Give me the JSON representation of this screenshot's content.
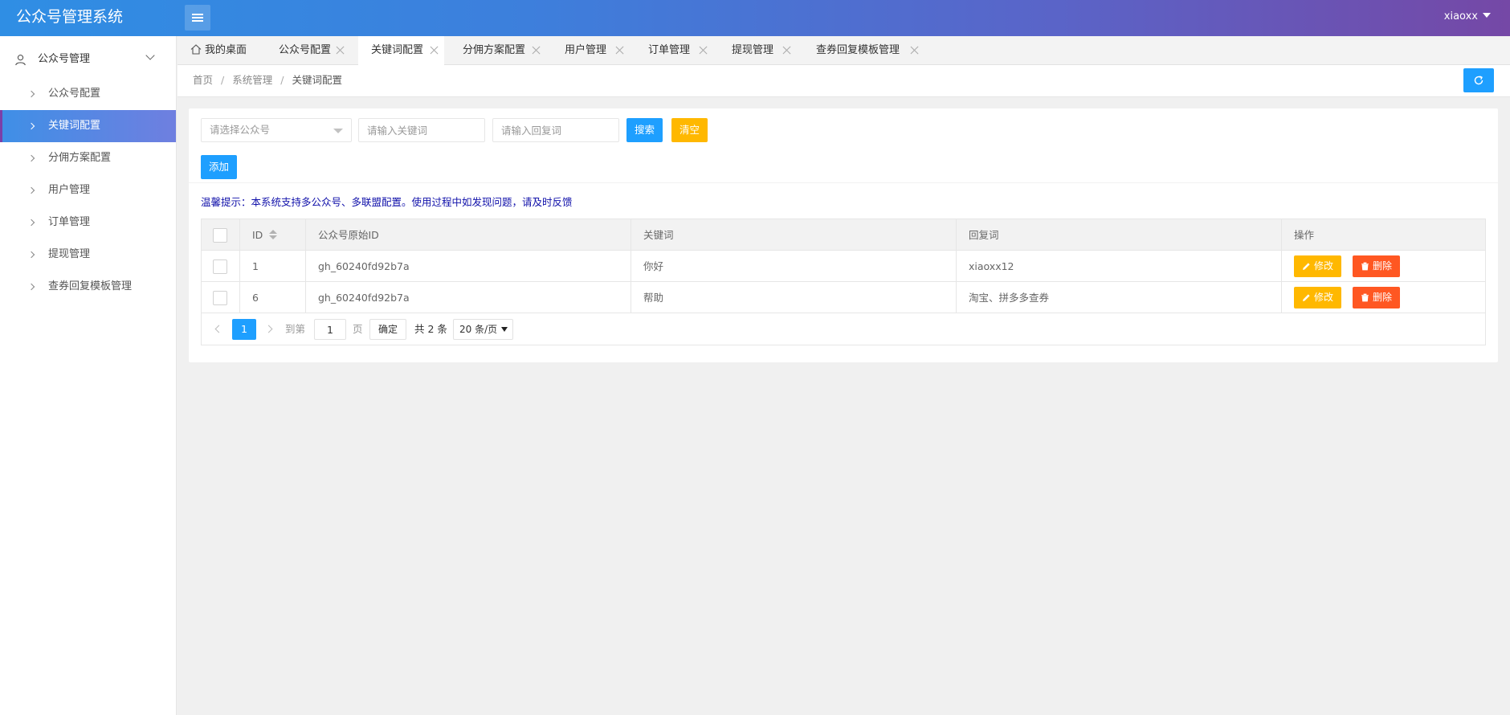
{
  "app": {
    "title": "公众号管理系统",
    "user": "xiaoxx"
  },
  "sidebar": {
    "group_label": "公众号管理",
    "items": [
      {
        "label": "公众号配置"
      },
      {
        "label": "关键词配置",
        "active": true
      },
      {
        "label": "分佣方案配置"
      },
      {
        "label": "用户管理"
      },
      {
        "label": "订单管理"
      },
      {
        "label": "提现管理"
      },
      {
        "label": "查券回复模板管理"
      }
    ]
  },
  "tabs": [
    {
      "label": "我的桌面",
      "icon": "home-icon"
    },
    {
      "label": "公众号配置"
    },
    {
      "label": "关键词配置",
      "active": true
    },
    {
      "label": "分佣方案配置"
    },
    {
      "label": "用户管理"
    },
    {
      "label": "订单管理"
    },
    {
      "label": "提现管理"
    },
    {
      "label": "查券回复模板管理"
    }
  ],
  "breadcrumb": {
    "items": [
      "首页",
      "系统管理",
      "关键词配置"
    ],
    "separator": "/"
  },
  "search": {
    "account_placeholder": "请选择公众号",
    "keyword_placeholder": "请输入关键词",
    "reply_placeholder": "请输入回复词",
    "search_label": "搜索",
    "clear_label": "清空"
  },
  "add_label": "添加",
  "tip": "温馨提示：本系统支持多公众号、多联盟配置。使用过程中如发现问题，请及时反馈",
  "table": {
    "columns": [
      "ID",
      "公众号原始ID",
      "关键词",
      "回复词",
      "操作"
    ],
    "rows": [
      {
        "id": "1",
        "account_id": "gh_60240fd92b7a",
        "keyword": "你好",
        "reply": "xiaoxx12"
      },
      {
        "id": "6",
        "account_id": "gh_60240fd92b7a",
        "keyword": "帮助",
        "reply": "淘宝、拼多多查券"
      }
    ],
    "edit_label": "修改",
    "delete_label": "删除"
  },
  "pager": {
    "current": "1",
    "goto_label": "到第",
    "page_value": "1",
    "page_unit": "页",
    "confirm_label": "确定",
    "total": "共 2 条",
    "page_size": "20 条/页"
  },
  "colors": {
    "primary": "#1e9fff",
    "warning": "#ffb800",
    "danger": "#ff5722",
    "header_start": "#2f8ee4",
    "header_end": "#7548a6"
  }
}
